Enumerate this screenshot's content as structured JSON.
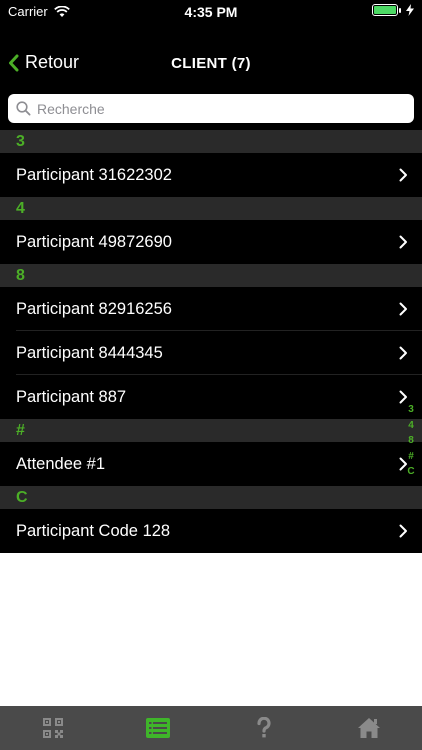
{
  "status": {
    "carrier": "Carrier",
    "time": "4:35 PM"
  },
  "nav": {
    "back_label": "Retour",
    "title": "CLIENT (7)"
  },
  "search": {
    "placeholder": "Recherche"
  },
  "sections": [
    {
      "header": "3",
      "rows": [
        "Participant 31622302"
      ]
    },
    {
      "header": "4",
      "rows": [
        "Participant 49872690"
      ]
    },
    {
      "header": "8",
      "rows": [
        "Participant 82916256",
        "Participant 8444345",
        "Participant 887"
      ]
    },
    {
      "header": "#",
      "rows": [
        "Attendee #1"
      ]
    },
    {
      "header": "C",
      "rows": [
        "Participant Code 128"
      ]
    }
  ],
  "index": [
    "3",
    "4",
    "8",
    "#",
    "C"
  ],
  "tabs": [
    {
      "icon": "qr-code-icon",
      "active": false
    },
    {
      "icon": "list-icon",
      "active": true
    },
    {
      "icon": "help-icon",
      "active": false
    },
    {
      "icon": "home-icon",
      "active": false
    }
  ],
  "colors": {
    "accent": "#4caf27",
    "header_bg": "#2a2a2a",
    "tabbar_bg": "#4a4a4a",
    "inactive_icon": "#8a8a8a"
  }
}
